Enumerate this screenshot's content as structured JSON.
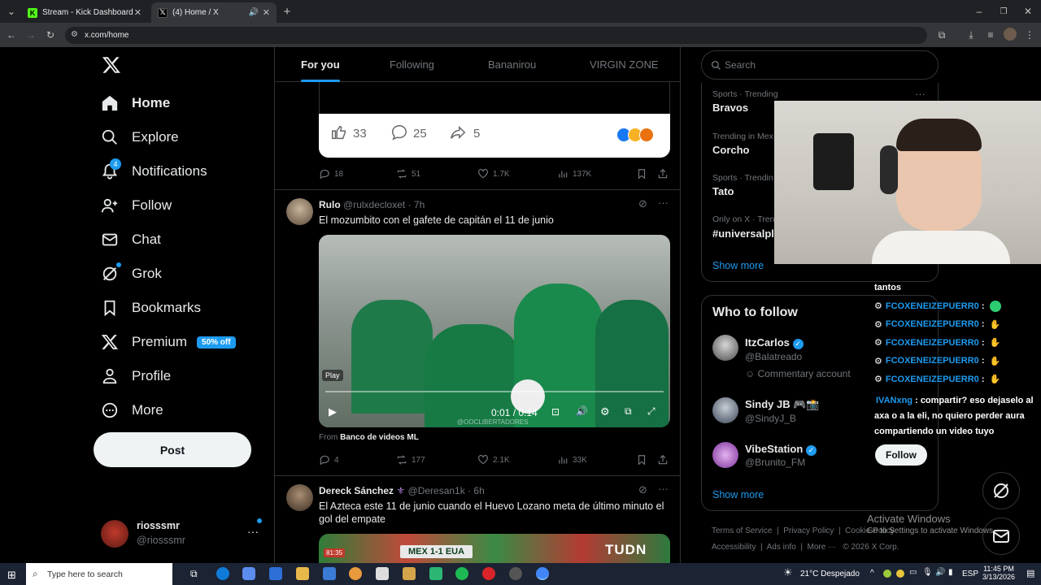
{
  "browser": {
    "tabs": [
      {
        "label": "Stream - Kick Dashboard"
      },
      {
        "label": "(4) Home / X"
      }
    ],
    "url": "x.com/home"
  },
  "nav": {
    "items": [
      {
        "label": "Home"
      },
      {
        "label": "Explore"
      },
      {
        "label": "Notifications",
        "badge": "4"
      },
      {
        "label": "Follow"
      },
      {
        "label": "Chat"
      },
      {
        "label": "Grok"
      },
      {
        "label": "Bookmarks"
      },
      {
        "label": "Premium",
        "badge": "50% off"
      },
      {
        "label": "Profile"
      },
      {
        "label": "More"
      }
    ],
    "post_label": "Post",
    "account": {
      "name": "riosssmr",
      "handle": "@riosssmr"
    }
  },
  "feed": {
    "tabs": [
      "For you",
      "Following",
      "Bananirou",
      "VIRGIN ZONE"
    ],
    "embed": {
      "likes": "33",
      "comments": "25",
      "shares": "5"
    },
    "tweet0_actions": {
      "replies": "18",
      "reposts": "51",
      "likes": "1.7K",
      "views": "137K"
    },
    "tweet1": {
      "name": "Rulo",
      "handle": "@rulxdecloxet",
      "time": "· 7h",
      "text": "El mozumbito con el gafete de capitán el 11 de junio",
      "video": {
        "play_tooltip": "Play",
        "time": "0:01 / 0:14",
        "watermark": "@OOCLIBERTADORES"
      },
      "from_prefix": "From",
      "from_source": "Banco de videos ML",
      "actions": {
        "replies": "4",
        "reposts": "177",
        "likes": "2.1K",
        "views": "33K"
      }
    },
    "tweet2": {
      "name": "Dereck Sánchez",
      "handle": "@Deresan1k",
      "time": "· 6h",
      "text": "El Azteca este 11 de junio cuando el Huevo Lozano meta de último minuto el gol del empate",
      "scoreboard": "MEX 1-1 EUA",
      "broadcaster": "TUDN",
      "clock": "81:35"
    }
  },
  "right": {
    "search_placeholder": "Search",
    "trends": [
      {
        "meta": "Sports · Trending",
        "name": "Bravos"
      },
      {
        "meta": "Trending in Mex",
        "name": "Corcho"
      },
      {
        "meta": "Sports · Trendin",
        "name": "Tato"
      },
      {
        "meta": "Only on X · Tren",
        "name": "#universalpl"
      }
    ],
    "show_more": "Show more",
    "who_to_follow_title": "Who to follow",
    "suggestions": [
      {
        "name": "ItzCarlos",
        "handle": "@Balatreado",
        "note": "Commentary account",
        "verified": true
      },
      {
        "name": "Sindy JB 🎮📸",
        "handle": "@SindyJ_B",
        "verified": false
      },
      {
        "name": "VibeStation",
        "handle": "@Brunito_FM",
        "verified": true
      }
    ],
    "follow_label": "Follow",
    "show_more_2": "Show more",
    "footer": [
      "Terms of Service",
      "Privacy Policy",
      "Cookie Policy",
      "Accessibility",
      "Ads info",
      "More ···",
      "© 2026 X Corp."
    ]
  },
  "overlay_chat": {
    "lines": [
      {
        "text": "tantos"
      },
      {
        "user": "FCOXENEIZEPUERR0",
        "msg": ":"
      },
      {
        "user": "FCOXENEIZEPUERR0",
        "msg": ":"
      },
      {
        "user": "FCOXENEIZEPUERR0",
        "msg": ":"
      },
      {
        "user": "FCOXENEIZEPUERR0",
        "msg": ":"
      },
      {
        "user": "FCOXENEIZEPUERR0",
        "msg": ":"
      }
    ],
    "message": {
      "user": "IVANxng",
      "text": ": compartir? eso dejaselo al axa o a la eli, no quiero perder aura compartiendo un video tuyo"
    }
  },
  "windows": {
    "activate_title": "Activate Windows",
    "activate_sub": "Go to Settings to activate Windows.",
    "search_placeholder": "Type here to search",
    "weather": "21°C Despejado",
    "lang": "ESP",
    "time": "11:45 PM",
    "date": "3/13/2026"
  }
}
